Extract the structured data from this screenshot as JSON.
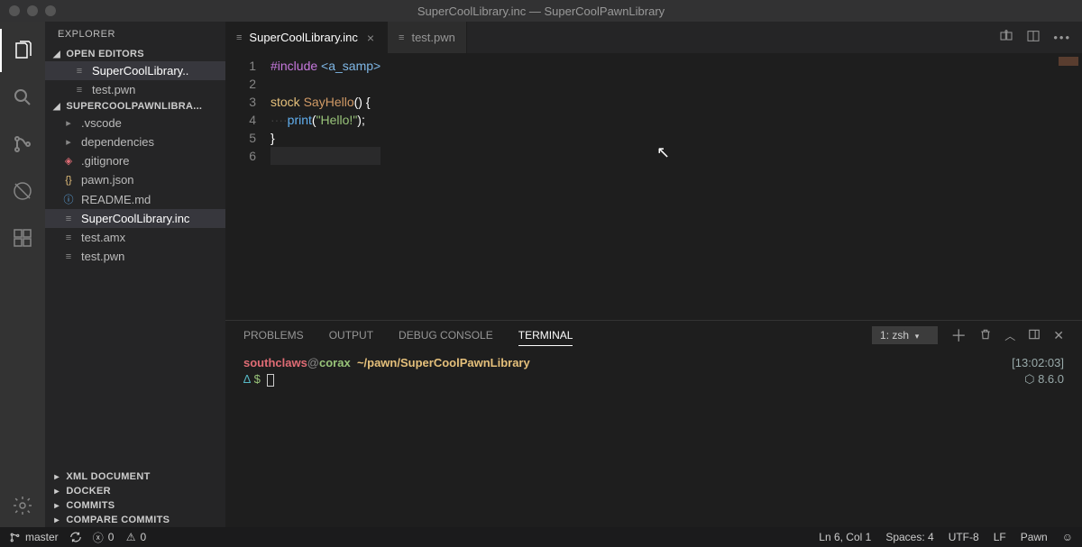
{
  "titlebar": {
    "title": "SuperCoolLibrary.inc — SuperCoolPawnLibrary"
  },
  "sidebar": {
    "title": "EXPLORER",
    "open_editors_label": "OPEN EDITORS",
    "open_editors": [
      {
        "name": "SuperCoolLibrary..",
        "active": true
      },
      {
        "name": "test.pwn",
        "active": false
      }
    ],
    "project_label": "SUPERCOOLPAWNLIBRA...",
    "files": [
      {
        "name": ".vscode",
        "folder": true
      },
      {
        "name": "dependencies",
        "folder": true
      },
      {
        "name": ".gitignore",
        "folder": false,
        "icon": "git"
      },
      {
        "name": "pawn.json",
        "folder": false,
        "icon": "json"
      },
      {
        "name": "README.md",
        "folder": false,
        "icon": "info"
      },
      {
        "name": "SuperCoolLibrary.inc",
        "folder": false,
        "icon": "file",
        "active": true
      },
      {
        "name": "test.amx",
        "folder": false,
        "icon": "file"
      },
      {
        "name": "test.pwn",
        "folder": false,
        "icon": "file"
      }
    ],
    "collapsed": [
      "XML DOCUMENT",
      "DOCKER",
      "COMMITS",
      "COMPARE COMMITS"
    ]
  },
  "tabs": [
    {
      "label": "SuperCoolLibrary.inc",
      "active": true
    },
    {
      "label": "test.pwn",
      "active": false
    }
  ],
  "code": {
    "lines": [
      {
        "n": 1,
        "html": "<span class='tok-include2'>#include</span> <span class='tok-include'>&lt;a_samp&gt;</span>"
      },
      {
        "n": 2,
        "html": ""
      },
      {
        "n": 3,
        "html": "<span class='tok-ident'>stock</span> <span class='tok-fn'>SayHello</span><span class='tok-punc'>() {</span>"
      },
      {
        "n": 4,
        "html": "<span class='ws-dot'>····</span><span class='tok-call'>print</span><span class='tok-punc'>(</span><span class='tok-str'>\"Hello!\"</span><span class='tok-punc'>);</span>"
      },
      {
        "n": 5,
        "html": "<span class='tok-punc'>}</span>"
      },
      {
        "n": 6,
        "html": "",
        "current": true
      }
    ],
    "chart_data_note": "source code text available above as tokenized spans"
  },
  "panel": {
    "tabs": [
      "PROBLEMS",
      "OUTPUT",
      "DEBUG CONSOLE",
      "TERMINAL"
    ],
    "active_tab": "TERMINAL",
    "term_selector": "1: zsh",
    "terminal": {
      "user": "southclaws",
      "host": "corax",
      "path": "~/pawn/SuperCoolPawnLibrary",
      "time": "[13:02:03]",
      "version": "8.6.0",
      "prompt_delta": "∆",
      "prompt_dollar": "$"
    }
  },
  "status": {
    "branch": "master",
    "sync": "⟳",
    "errors": "0",
    "warnings": "0",
    "cursor": "Ln 6, Col 1",
    "spaces": "Spaces: 4",
    "encoding": "UTF-8",
    "eol": "LF",
    "lang": "Pawn"
  }
}
